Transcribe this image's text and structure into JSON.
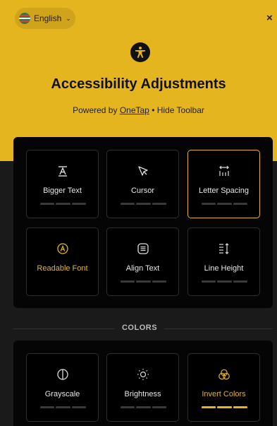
{
  "header": {
    "language": "English",
    "close_symbol": "×",
    "title": "Accessibility Adjustments",
    "powered_by": "Powered by",
    "brand": "OneTap",
    "separator": "•",
    "hide_toolbar": "Hide Toolbar",
    "accent_color": "#e4b51f"
  },
  "sections": {
    "colors_label": "COLORS"
  },
  "content_cards": [
    {
      "label": "Bigger Text",
      "icon": "text-size-icon",
      "active": false,
      "level": 0
    },
    {
      "label": "Cursor",
      "icon": "cursor-icon",
      "active": false,
      "level": 0
    },
    {
      "label": "Letter Spacing",
      "icon": "letter-spacing-icon",
      "active": true,
      "level": 0
    },
    {
      "label": "Readable Font",
      "icon": "readable-font-icon",
      "active": true,
      "level": 0
    },
    {
      "label": "Align Text",
      "icon": "align-text-icon",
      "active": false,
      "level": 0
    },
    {
      "label": "Line Height",
      "icon": "line-height-icon",
      "active": false,
      "level": 0
    }
  ],
  "color_cards": [
    {
      "label": "Grayscale",
      "icon": "grayscale-icon",
      "active": false,
      "level": 0
    },
    {
      "label": "Brightness",
      "icon": "brightness-icon",
      "active": false,
      "level": 0
    },
    {
      "label": "Invert Colors",
      "icon": "invert-colors-icon",
      "active": true,
      "level": 3
    }
  ]
}
